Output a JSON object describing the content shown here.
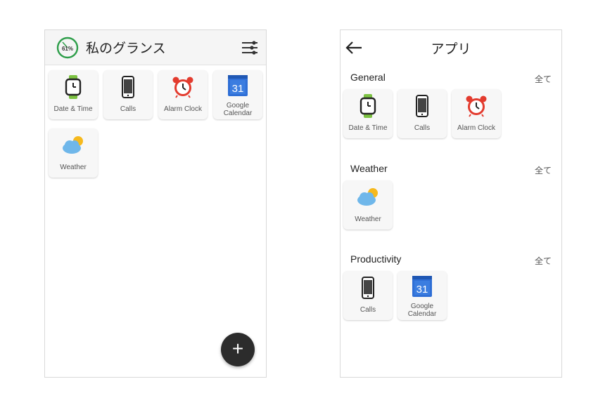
{
  "left": {
    "battery_text": "61%",
    "title": "私のグランス",
    "tiles": [
      {
        "label": "Date & Time",
        "icon": "watch-icon"
      },
      {
        "label": "Calls",
        "icon": "phone-icon"
      },
      {
        "label": "Alarm Clock",
        "icon": "alarm-clock-icon"
      },
      {
        "label_line1": "Google",
        "label_line2": "Calendar",
        "icon": "calendar-icon",
        "day": "31"
      },
      {
        "label": "Weather",
        "icon": "weather-icon"
      }
    ],
    "fab_label": "+"
  },
  "right": {
    "title": "アプリ",
    "sections": [
      {
        "title": "General",
        "see_all": "全て",
        "tiles": [
          {
            "label": "Date & Time",
            "icon": "watch-icon"
          },
          {
            "label": "Calls",
            "icon": "phone-icon"
          },
          {
            "label": "Alarm Clock",
            "icon": "alarm-clock-icon"
          }
        ]
      },
      {
        "title": "Weather",
        "see_all": "全て",
        "tiles": [
          {
            "label": "Weather",
            "icon": "weather-icon"
          }
        ]
      },
      {
        "title": "Productivity",
        "see_all": "全て",
        "tiles": [
          {
            "label": "Calls",
            "icon": "phone-icon"
          },
          {
            "label_line1": "Google",
            "label_line2": "Calendar",
            "icon": "calendar-icon",
            "day": "31"
          }
        ]
      }
    ]
  },
  "colors": {
    "battery_ring": "#2e9e4a",
    "watch_band": "#7cc242",
    "alarm_red": "#e33b2e",
    "calendar_blue": "#2f6fd6",
    "cloud_blue": "#6fb7ea",
    "sun_yellow": "#f6b91d",
    "fab": "#2c2c2c"
  }
}
